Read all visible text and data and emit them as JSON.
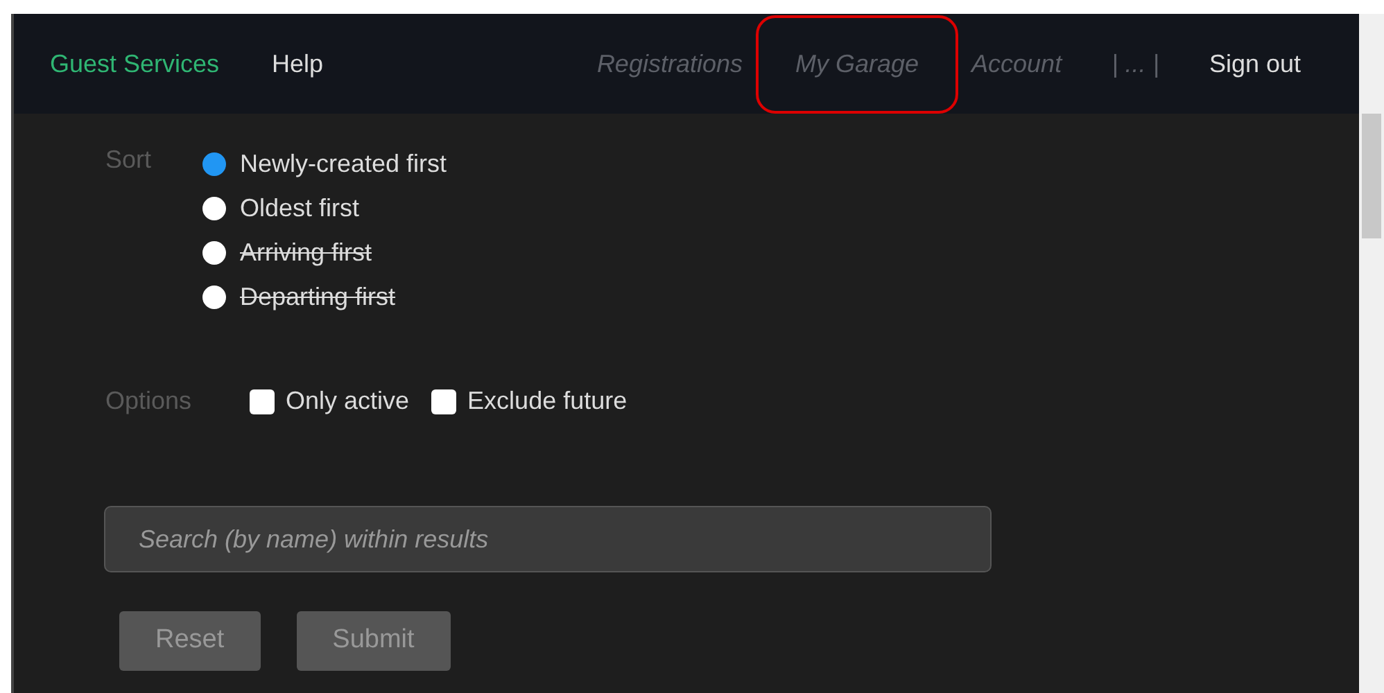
{
  "navbar": {
    "brand": "Guest Services",
    "left_items": [
      {
        "label": "Help",
        "disabled": false,
        "highlighted": false
      }
    ],
    "right_items": [
      {
        "label": "Registrations",
        "disabled": true,
        "highlighted": false
      },
      {
        "label": "My Garage",
        "disabled": true,
        "highlighted": true
      },
      {
        "label": "Account",
        "disabled": true,
        "highlighted": false
      },
      {
        "label": "| ... |",
        "disabled": true,
        "highlighted": false
      },
      {
        "label": "Sign out",
        "disabled": false,
        "highlighted": false
      }
    ]
  },
  "sort": {
    "label": "Sort",
    "options": [
      {
        "label": "Newly-created first",
        "selected": true,
        "disabled": false
      },
      {
        "label": "Oldest first",
        "selected": false,
        "disabled": false
      },
      {
        "label": "Arriving first",
        "selected": false,
        "disabled": true
      },
      {
        "label": "Departing first",
        "selected": false,
        "disabled": true
      }
    ]
  },
  "options": {
    "label": "Options",
    "checkboxes": [
      {
        "label": "Only active",
        "checked": false
      },
      {
        "label": "Exclude future",
        "checked": false
      }
    ]
  },
  "search": {
    "placeholder": "Search (by name) within results"
  },
  "buttons": [
    "Reset",
    "Submit"
  ]
}
